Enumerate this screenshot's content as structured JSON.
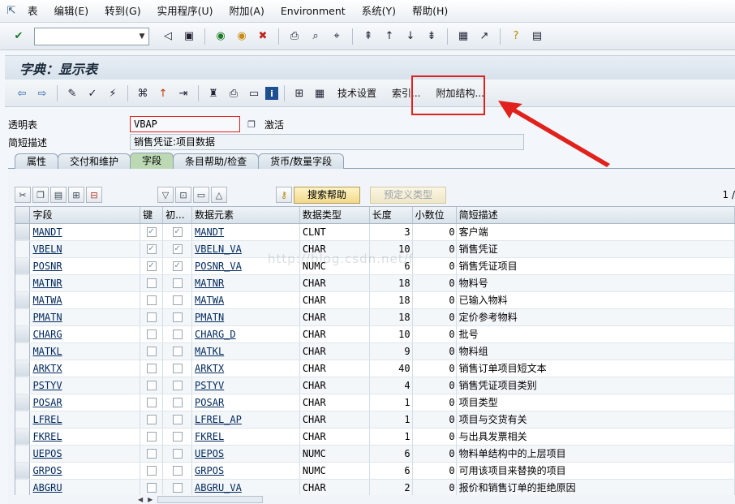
{
  "menu": {
    "app_icon": "exit-icon",
    "items": [
      "表",
      "编辑(E)",
      "转到(G)",
      "实用程序(U)",
      "附加(A)",
      "Environment",
      "系统(Y)",
      "帮助(H)"
    ]
  },
  "system_toolbar": {
    "command_value": ""
  },
  "title": "字典：显示表",
  "app_toolbar": {
    "tech_settings": "技术设置",
    "indexes": "索引...",
    "append_structure": "附加结构..."
  },
  "header": {
    "transparent_table_label": "透明表",
    "table_name": "VBAP",
    "status": "激活",
    "short_desc_label": "简短描述",
    "short_desc": "销售凭证:项目数据"
  },
  "tabs": [
    "属性",
    "交付和维护",
    "字段",
    "条目帮助/检查",
    "货币/数量字段"
  ],
  "active_tab": 2,
  "table_toolbar": {
    "search_help": "搜索帮助",
    "predefined_type": "预定义类型",
    "page": "1 /"
  },
  "columns": [
    "字段",
    "键",
    "初...",
    "数据元素",
    "数据类型",
    "长度",
    "小数位",
    "简短描述"
  ],
  "rows": [
    {
      "field": "MANDT",
      "key": true,
      "init": true,
      "element": "MANDT",
      "type": "CLNT",
      "len": "3",
      "dec": "0",
      "desc": "客户端"
    },
    {
      "field": "VBELN",
      "key": true,
      "init": true,
      "element": "VBELN_VA",
      "type": "CHAR",
      "len": "10",
      "dec": "0",
      "desc": "销售凭证"
    },
    {
      "field": "POSNR",
      "key": true,
      "init": true,
      "element": "POSNR_VA",
      "type": "NUMC",
      "len": "6",
      "dec": "0",
      "desc": "销售凭证项目"
    },
    {
      "field": "MATNR",
      "key": false,
      "init": false,
      "element": "MATNR",
      "type": "CHAR",
      "len": "18",
      "dec": "0",
      "desc": "物料号"
    },
    {
      "field": "MATWA",
      "key": false,
      "init": false,
      "element": "MATWA",
      "type": "CHAR",
      "len": "18",
      "dec": "0",
      "desc": "已输入物料"
    },
    {
      "field": "PMATN",
      "key": false,
      "init": false,
      "element": "PMATN",
      "type": "CHAR",
      "len": "18",
      "dec": "0",
      "desc": "定价参考物料"
    },
    {
      "field": "CHARG",
      "key": false,
      "init": false,
      "element": "CHARG_D",
      "type": "CHAR",
      "len": "10",
      "dec": "0",
      "desc": "批号"
    },
    {
      "field": "MATKL",
      "key": false,
      "init": false,
      "element": "MATKL",
      "type": "CHAR",
      "len": "9",
      "dec": "0",
      "desc": "物料组"
    },
    {
      "field": "ARKTX",
      "key": false,
      "init": false,
      "element": "ARKTX",
      "type": "CHAR",
      "len": "40",
      "dec": "0",
      "desc": "销售订单项目短文本"
    },
    {
      "field": "PSTYV",
      "key": false,
      "init": false,
      "element": "PSTYV",
      "type": "CHAR",
      "len": "4",
      "dec": "0",
      "desc": "销售凭证项目类别"
    },
    {
      "field": "POSAR",
      "key": false,
      "init": false,
      "element": "POSAR",
      "type": "CHAR",
      "len": "1",
      "dec": "0",
      "desc": "项目类型"
    },
    {
      "field": "LFREL",
      "key": false,
      "init": false,
      "element": "LFREL_AP",
      "type": "CHAR",
      "len": "1",
      "dec": "0",
      "desc": "项目与交货有关"
    },
    {
      "field": "FKREL",
      "key": false,
      "init": false,
      "element": "FKREL",
      "type": "CHAR",
      "len": "1",
      "dec": "0",
      "desc": " 与出具发票相关"
    },
    {
      "field": "UEPOS",
      "key": false,
      "init": false,
      "element": "UEPOS",
      "type": "NUMC",
      "len": "6",
      "dec": "0",
      "desc": "物料单结构中的上层项目"
    },
    {
      "field": "GRPOS",
      "key": false,
      "init": false,
      "element": "GRPOS",
      "type": "NUMC",
      "len": "6",
      "dec": "0",
      "desc": "可用该项目来替换的项目"
    },
    {
      "field": "ABGRU",
      "key": false,
      "init": false,
      "element": "ABGRU_VA",
      "type": "CHAR",
      "len": "2",
      "dec": "0",
      "desc": "报价和销售订单的拒绝原因"
    }
  ],
  "watermark": "http://blog.csdn.net/f",
  "colors": {
    "highlight": "#e0211c",
    "active_tab": "#bcd9b4",
    "push_button": "#f1d98b"
  }
}
